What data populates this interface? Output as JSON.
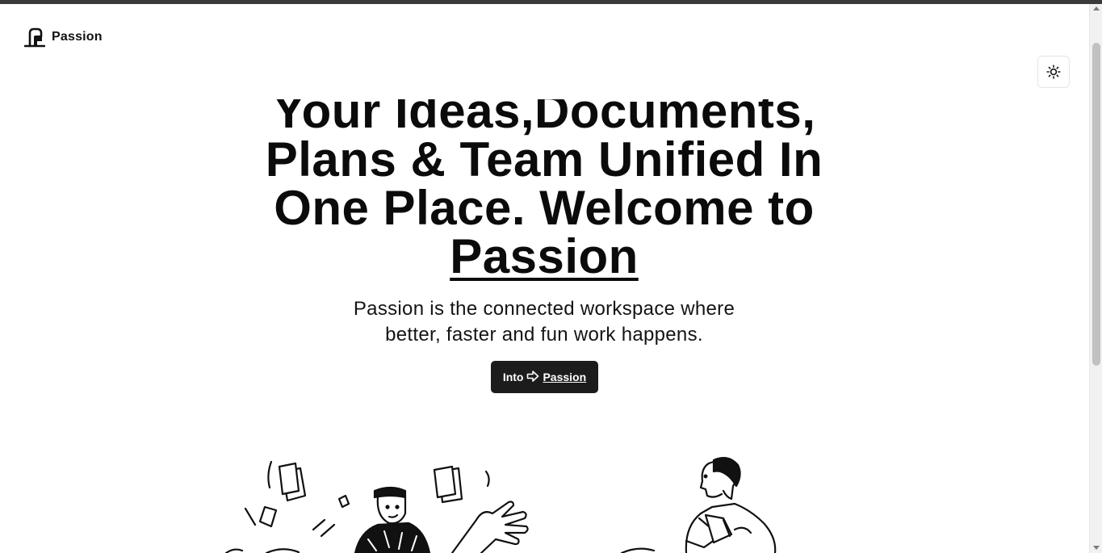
{
  "header": {
    "brand_name": "Passion",
    "theme_toggle_icon": "sun-icon"
  },
  "hero": {
    "headline_line1": "Your Ideas,Documents,",
    "headline_line2": "Plans & Team Unified In",
    "headline_line3": "One Place. Welcome to",
    "headline_brand": "Passion",
    "subtitle_line1": "Passion is the connected workspace where",
    "subtitle_line2": "better, faster and fun work happens.",
    "cta_prefix": "Into",
    "cta_icon": "arrow-right-icon",
    "cta_brand": "Passion"
  },
  "colors": {
    "text": "#0b0b0b",
    "button_bg": "#1c1c1c",
    "button_text": "#ffffff",
    "page_bg": "#ffffff"
  }
}
